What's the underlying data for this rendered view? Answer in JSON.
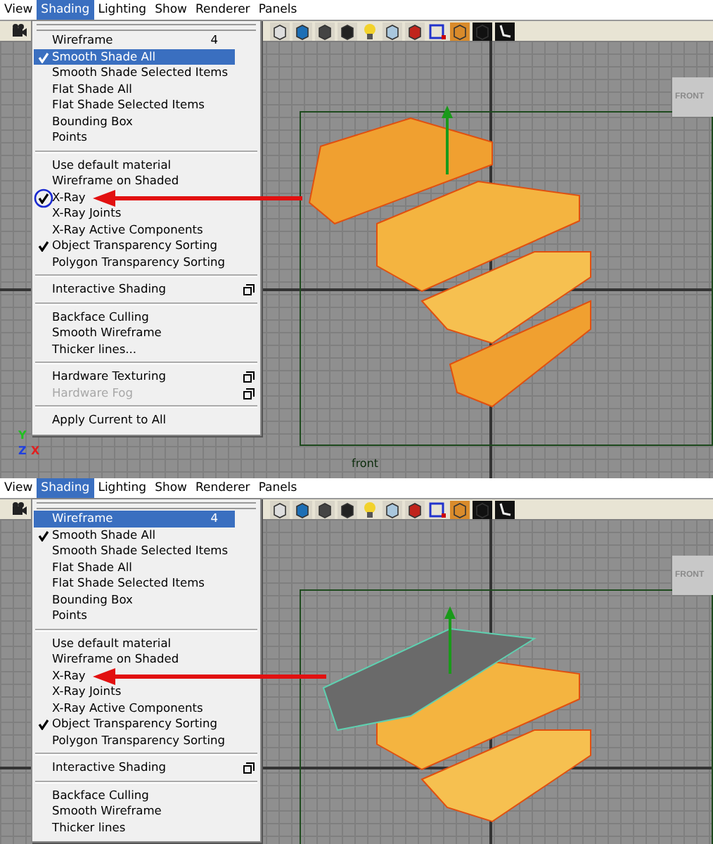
{
  "panels": [
    {
      "menubar": [
        {
          "label": "View",
          "selected": false
        },
        {
          "label": "Shading",
          "selected": true
        },
        {
          "label": "Lighting",
          "selected": false
        },
        {
          "label": "Show",
          "selected": false
        },
        {
          "label": "Renderer",
          "selected": false
        },
        {
          "label": "Panels",
          "selected": false
        }
      ],
      "menu": {
        "sections": [
          [
            {
              "label": "Wireframe",
              "shortcut": "4",
              "checked": false,
              "highlighted": false
            },
            {
              "label": "Smooth Shade All",
              "checked": true,
              "highlighted": true
            },
            {
              "label": "Smooth Shade Selected Items",
              "checked": false,
              "highlighted": false
            },
            {
              "label": "Flat Shade All",
              "checked": false,
              "highlighted": false
            },
            {
              "label": "Flat Shade Selected Items",
              "checked": false,
              "highlighted": false
            },
            {
              "label": "Bounding Box",
              "checked": false,
              "highlighted": false
            },
            {
              "label": "Points",
              "checked": false,
              "highlighted": false
            }
          ],
          [
            {
              "label": "Use default material",
              "checked": false,
              "highlighted": false
            },
            {
              "label": "Wireframe on Shaded",
              "checked": false,
              "highlighted": false
            },
            {
              "label": "X-Ray",
              "checked": true,
              "highlighted": false,
              "circled": true
            },
            {
              "label": "X-Ray Joints",
              "checked": false,
              "highlighted": false
            },
            {
              "label": "X-Ray Active Components",
              "checked": false,
              "highlighted": false
            },
            {
              "label": "Object Transparency Sorting",
              "checked": true,
              "highlighted": false
            },
            {
              "label": "Polygon Transparency Sorting",
              "checked": false,
              "highlighted": false
            }
          ],
          [
            {
              "label": "Interactive Shading",
              "checked": false,
              "highlighted": false,
              "option_box": true
            }
          ],
          [
            {
              "label": "Backface Culling",
              "checked": false,
              "highlighted": false
            },
            {
              "label": "Smooth Wireframe",
              "checked": false,
              "highlighted": false
            },
            {
              "label": "Thicker lines...",
              "checked": false,
              "highlighted": false
            }
          ],
          [
            {
              "label": "Hardware Texturing",
              "checked": false,
              "highlighted": false,
              "option_box": true
            },
            {
              "label": "Hardware Fog",
              "checked": false,
              "highlighted": false,
              "option_box": true,
              "disabled": true
            }
          ],
          [
            {
              "label": "Apply Current to All",
              "checked": false,
              "highlighted": false
            }
          ]
        ]
      },
      "viewport": {
        "kind": "shaded",
        "view_cube_label": "FRONT",
        "camera_label": "front",
        "axes": [
          "Y",
          "Z",
          "X"
        ]
      }
    },
    {
      "menubar": [
        {
          "label": "View",
          "selected": false
        },
        {
          "label": "Shading",
          "selected": true
        },
        {
          "label": "Lighting",
          "selected": false
        },
        {
          "label": "Show",
          "selected": false
        },
        {
          "label": "Renderer",
          "selected": false
        },
        {
          "label": "Panels",
          "selected": false
        }
      ],
      "menu": {
        "sections": [
          [
            {
              "label": "Wireframe",
              "shortcut": "4",
              "checked": false,
              "highlighted": true
            },
            {
              "label": "Smooth Shade All",
              "checked": true,
              "highlighted": false
            },
            {
              "label": "Smooth Shade Selected Items",
              "checked": false,
              "highlighted": false
            },
            {
              "label": "Flat Shade All",
              "checked": false,
              "highlighted": false
            },
            {
              "label": "Flat Shade Selected Items",
              "checked": false,
              "highlighted": false
            },
            {
              "label": "Bounding Box",
              "checked": false,
              "highlighted": false
            },
            {
              "label": "Points",
              "checked": false,
              "highlighted": false
            }
          ],
          [
            {
              "label": "Use default material",
              "checked": false,
              "highlighted": false
            },
            {
              "label": "Wireframe on Shaded",
              "checked": false,
              "highlighted": false
            },
            {
              "label": "X-Ray",
              "checked": false,
              "highlighted": false
            },
            {
              "label": "X-Ray Joints",
              "checked": false,
              "highlighted": false
            },
            {
              "label": "X-Ray Active Components",
              "checked": false,
              "highlighted": false
            },
            {
              "label": "Object Transparency Sorting",
              "checked": true,
              "highlighted": false
            },
            {
              "label": "Polygon Transparency Sorting",
              "checked": false,
              "highlighted": false
            }
          ],
          [
            {
              "label": "Interactive Shading",
              "checked": false,
              "highlighted": false,
              "option_box": true
            }
          ],
          [
            {
              "label": "Backface Culling",
              "checked": false,
              "highlighted": false
            },
            {
              "label": "Smooth Wireframe",
              "checked": false,
              "highlighted": false
            },
            {
              "label": "Thicker lines",
              "checked": false,
              "highlighted": false
            }
          ]
        ]
      },
      "viewport": {
        "kind": "grey-top",
        "view_cube_label": "FRONT"
      }
    }
  ]
}
